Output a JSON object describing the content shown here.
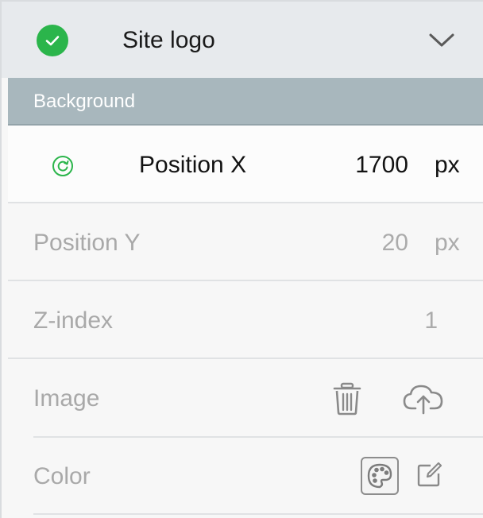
{
  "header": {
    "title": "Site logo",
    "status_icon": "check-circle-icon",
    "toggle_icon": "chevron-down-icon"
  },
  "section": {
    "title": "Background"
  },
  "rows": {
    "position_x": {
      "label": "Position X",
      "value": "1700",
      "unit": "px",
      "icon": "reset-icon"
    },
    "position_y": {
      "label": "Position Y",
      "value": "20",
      "unit": "px"
    },
    "z_index": {
      "label": "Z-index",
      "value": "1"
    },
    "image": {
      "label": "Image",
      "icons": [
        "trash-icon",
        "cloud-upload-icon"
      ]
    },
    "color": {
      "label": "Color",
      "icons": [
        "palette-icon",
        "edit-icon"
      ]
    }
  },
  "colors": {
    "accent_green": "#2bb54b",
    "section_bar": "#a8b7bd"
  }
}
